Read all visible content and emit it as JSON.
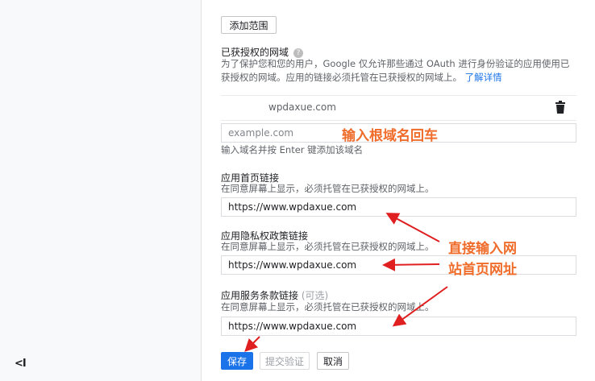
{
  "sidebar": {
    "collapse_label": "<I"
  },
  "add_scope_label": "添加范围",
  "authorized_domains": {
    "title": "已获授权的网域",
    "help_icon": "question-icon",
    "description_line1": "为了保护您和您的用户，Google 仅允许那些通过 OAuth 进行身份验证的应用使用已",
    "description_line2": "获授权的网域。应用的链接必须托管在已获授权的网域上。",
    "learn_more": "了解详情",
    "existing_domain": "wpdaxue.com",
    "delete_icon": "trash-icon",
    "input_placeholder": "example.com",
    "input_hint": "输入域名并按 Enter 键添加该域名"
  },
  "homepage": {
    "label": "应用首页链接",
    "hint": "在同意屏幕上显示，必须托管在已获授权的网域上。",
    "value": "https://www.wpdaxue.com"
  },
  "privacy": {
    "label": "应用隐私权政策链接",
    "hint": "在同意屏幕上显示，必须托管在已获授权的网域上。",
    "value": "https://www.wpdaxue.com"
  },
  "tos": {
    "label": "应用服务条款链接",
    "optional": "(可选)",
    "hint": "在同意屏幕上显示，必须托管在已获授权的网域上。",
    "value": "https://www.wpdaxue.com"
  },
  "buttons": {
    "save": "保存",
    "submit": "提交验证",
    "cancel": "取消"
  },
  "annotations": {
    "root_domain": "输入根域名回车",
    "homepage_line1": "直接输入网",
    "homepage_line2": "站首页网址"
  },
  "colors": {
    "accent": "#1a73e8",
    "annotation_text": "#ef6c2b",
    "arrow": "#e02020"
  }
}
